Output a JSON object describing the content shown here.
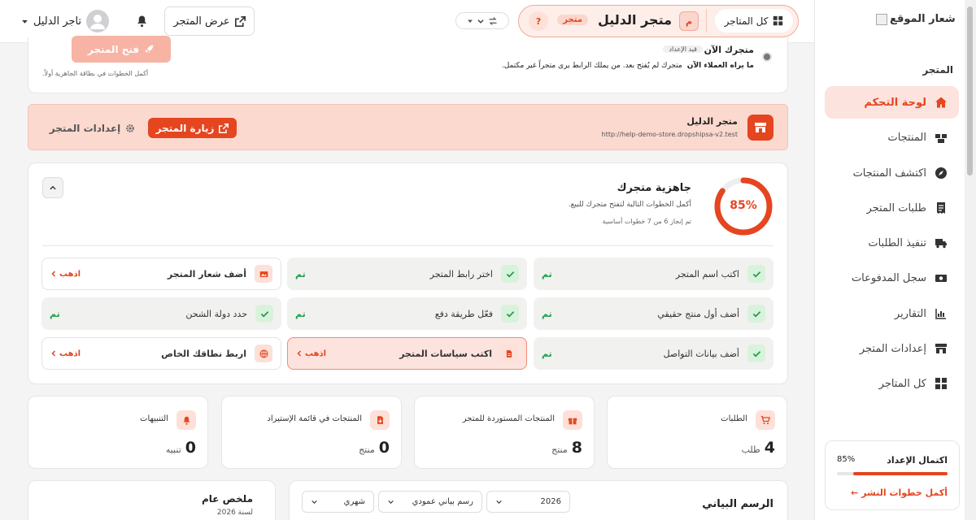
{
  "sidebar": {
    "logo_alt": "شعار الموقع",
    "section": "المتجر",
    "items": [
      {
        "label": "لوحة التحكم",
        "icon": "home-icon"
      },
      {
        "label": "المنتجات",
        "icon": "boxes-icon"
      },
      {
        "label": "اكتشف المنتجات",
        "icon": "compass-icon"
      },
      {
        "label": "طلبات المتجر",
        "icon": "receipt-icon"
      },
      {
        "label": "تنفيذ الطلبات",
        "icon": "truck-icon"
      },
      {
        "label": "سجل المدفوعات",
        "icon": "money-icon"
      },
      {
        "label": "التقارير",
        "icon": "chart-icon"
      },
      {
        "label": "إعدادات المتجر",
        "icon": "store-icon"
      },
      {
        "label": "كل المتاجر",
        "icon": "grid-icon"
      }
    ],
    "setup": {
      "title": "اكتمال الإعداد",
      "percent": "85%",
      "progress": 0.85,
      "link": "أكمل خطوات النشر ←"
    }
  },
  "header": {
    "all_stores": "كل المتاجر",
    "store_initial": "م",
    "store_name": "متجر الدليل",
    "store_badge": "متجر",
    "help": "?",
    "view_store": "عرض المتجر",
    "user_name": "تاجر الدليل"
  },
  "status_card": {
    "title": "متجرك الآن",
    "badge": "قيد الإعداد",
    "desc_bold": "ما يراه العملاء الآن",
    "desc": "متجرك لم يُفتح بعد. من يملك الرابط يرى متجراً غير مكتمل.",
    "open_button": "فتح المتجر",
    "hint": "أكمل الخطوات في بطاقة الجاهزية أولاً."
  },
  "store_banner": {
    "name": "متجر الدليل",
    "url": "http://help-demo-store.dropshipsa-v2.test",
    "visit": "زيارة المتجر",
    "settings": "إعدادات المتجر"
  },
  "readiness": {
    "title": "جاهزية متجرك",
    "subtitle": "أكمل الخطوات التالية لتفتح متجرك للبيع.",
    "progress_text": "تم إنجاز 6 من 7 خطوات أساسية",
    "percent_label": "85%",
    "percent": 0.85,
    "steps": [
      {
        "label": "اكتب اسم المتجر",
        "status": "تم"
      },
      {
        "label": "اختر رابط المتجر",
        "status": "تم"
      },
      {
        "label": "أضف شعار المتجر",
        "status": "اذهب"
      },
      {
        "label": "أضف أول منتج حقيقي",
        "status": "تم"
      },
      {
        "label": "فعّل طريقة دفع",
        "status": "تم"
      },
      {
        "label": "حدد دولة الشحن",
        "status": "تم"
      },
      {
        "label": "أضف بيانات التواصل",
        "status": "تم"
      },
      {
        "label": "اكتب سياسات المتجر",
        "status": "اذهب"
      },
      {
        "label": "اربط نطاقك الخاص",
        "status": "اذهب"
      }
    ]
  },
  "stats": [
    {
      "label": "الطلبات",
      "value": "4",
      "unit": "طلب",
      "icon": "cart-icon"
    },
    {
      "label": "المنتجات المستوردة للمتجر",
      "value": "8",
      "unit": "منتج",
      "icon": "gift-icon"
    },
    {
      "label": "المنتجات في قائمة الإستيراد",
      "value": "0",
      "unit": "منتج",
      "icon": "import-icon"
    },
    {
      "label": "التنبيهات",
      "value": "0",
      "unit": "تنبيه",
      "icon": "bell-icon"
    }
  ],
  "chart_panel": {
    "title": "الرسم البياني",
    "year": "2026",
    "chart_type": "رسم بياني عمودي",
    "period": "شهري"
  },
  "summary": {
    "title": "ملخص عام",
    "year_label": "لسنة 2026"
  }
}
